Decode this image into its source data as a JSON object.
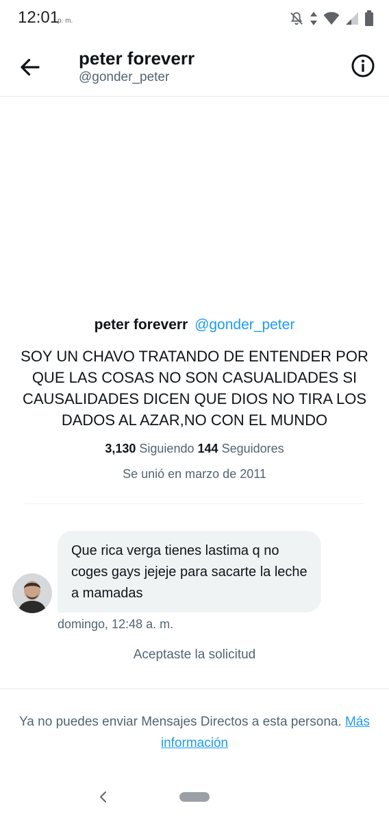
{
  "status_bar": {
    "time": "12:01",
    "ampm": "p. m."
  },
  "header": {
    "name": "peter foreverr",
    "handle": "@gonder_peter"
  },
  "profile": {
    "name": "peter foreverr",
    "handle": "@gonder_peter",
    "bio": "SOY UN CHAVO TRATANDO DE ENTENDER POR QUE LAS COSAS NO SON CASUALIDADES SI CAUSALIDADES DICEN QUE DIOS NO TIRA LOS DADOS AL AZAR,NO CON EL MUNDO",
    "following_count": "3,130",
    "following_label": "Siguiendo",
    "followers_count": "144",
    "followers_label": "Seguidores",
    "joined": "Se unió en marzo de 2011"
  },
  "messages": [
    {
      "text": "Que rica verga tienes lastima q no coges gays jejeje para sacarte la leche a mamadas",
      "time": "domingo, 12:48 a. m."
    }
  ],
  "accepted_text": "Aceptaste la solicitud",
  "footer": {
    "text": "Ya no puedes enviar Mensajes Directos a esta persona.",
    "link": "Más información"
  },
  "icons": [
    "mute-bell-icon",
    "data-arrows-icon",
    "wifi-icon",
    "signal-icon",
    "battery-icon",
    "back-arrow-icon",
    "info-icon",
    "nav-back-icon"
  ]
}
